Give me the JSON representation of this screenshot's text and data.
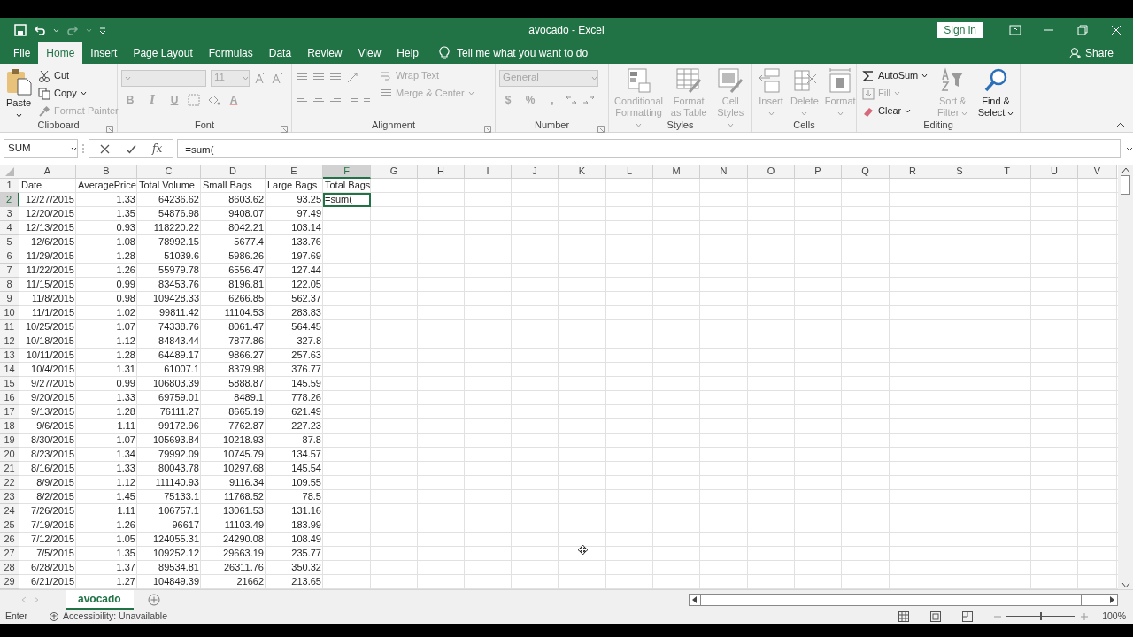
{
  "window": {
    "title": "avocado - Excel",
    "sign_in": "Sign in"
  },
  "ribbon_tabs": [
    {
      "label": "File",
      "selected": false
    },
    {
      "label": "Home",
      "selected": true
    },
    {
      "label": "Insert",
      "selected": false
    },
    {
      "label": "Page Layout",
      "selected": false
    },
    {
      "label": "Formulas",
      "selected": false
    },
    {
      "label": "Data",
      "selected": false
    },
    {
      "label": "Review",
      "selected": false
    },
    {
      "label": "View",
      "selected": false
    },
    {
      "label": "Help",
      "selected": false
    }
  ],
  "tell_me": "Tell me what you want to do",
  "share": "Share",
  "ribbon": [
    {
      "label": "Clipboard",
      "items": [
        {
          "kind": "large",
          "label": "Paste",
          "disabled": false,
          "dropdown": true
        },
        {
          "kind": "small",
          "label": "Cut",
          "disabled": false
        },
        {
          "kind": "small",
          "label": "Copy",
          "disabled": false,
          "dropdown": true
        },
        {
          "kind": "small",
          "label": "Format Painter",
          "disabled": true
        }
      ]
    },
    {
      "label": "Font",
      "items": [
        {
          "kind": "combo",
          "value": "11",
          "disabled": true
        },
        {
          "kind": "glyph",
          "label": "B",
          "disabled": true
        },
        {
          "kind": "glyph",
          "label": "I",
          "disabled": true
        },
        {
          "kind": "glyph",
          "label": "U",
          "disabled": true
        },
        {
          "kind": "glyph",
          "label": "A",
          "disabled": true
        }
      ]
    },
    {
      "label": "Alignment",
      "items": [
        {
          "kind": "small",
          "label": "Wrap Text",
          "disabled": true
        },
        {
          "kind": "small",
          "label": "Merge & Center",
          "disabled": true,
          "dropdown": true
        }
      ]
    },
    {
      "label": "Number",
      "items": [
        {
          "kind": "combo",
          "value": "General",
          "disabled": true
        },
        {
          "kind": "glyph",
          "label": "$",
          "disabled": true
        },
        {
          "kind": "glyph",
          "label": "%",
          "disabled": true
        },
        {
          "kind": "glyph",
          "label": ",",
          "disabled": true
        }
      ]
    },
    {
      "label": "Styles",
      "items": [
        {
          "kind": "large",
          "label": "Conditional Formatting",
          "disabled": true,
          "dropdown": true
        },
        {
          "kind": "large",
          "label": "Format as Table",
          "disabled": true,
          "dropdown": true
        },
        {
          "kind": "large",
          "label": "Cell Styles",
          "disabled": true,
          "dropdown": true
        }
      ]
    },
    {
      "label": "Cells",
      "items": [
        {
          "kind": "large",
          "label": "Insert",
          "disabled": true,
          "dropdown": true
        },
        {
          "kind": "large",
          "label": "Delete",
          "disabled": true,
          "dropdown": true
        },
        {
          "kind": "large",
          "label": "Format",
          "disabled": true,
          "dropdown": true
        }
      ]
    },
    {
      "label": "Editing",
      "items": [
        {
          "kind": "small",
          "label": "AutoSum",
          "disabled": false,
          "dropdown": true
        },
        {
          "kind": "small",
          "label": "Fill",
          "disabled": true,
          "dropdown": true
        },
        {
          "kind": "small",
          "label": "Clear",
          "disabled": false,
          "dropdown": true
        },
        {
          "kind": "large",
          "label": "Sort & Filter",
          "disabled": true,
          "dropdown": true
        },
        {
          "kind": "large",
          "label": "Find & Select",
          "disabled": false,
          "dropdown": true
        }
      ]
    }
  ],
  "formula_bar": {
    "name_box": "SUM",
    "function_label": "fx",
    "formula": "=sum("
  },
  "columns": [
    {
      "label": "A",
      "selected": false
    },
    {
      "label": "B",
      "selected": false
    },
    {
      "label": "C",
      "selected": false
    },
    {
      "label": "D",
      "selected": false
    },
    {
      "label": "E",
      "selected": false
    },
    {
      "label": "F",
      "selected": true
    },
    {
      "label": "G",
      "selected": false
    },
    {
      "label": "H",
      "selected": false
    },
    {
      "label": "I",
      "selected": false
    },
    {
      "label": "J",
      "selected": false
    },
    {
      "label": "K",
      "selected": false
    },
    {
      "label": "L",
      "selected": false
    },
    {
      "label": "M",
      "selected": false
    },
    {
      "label": "N",
      "selected": false
    },
    {
      "label": "O",
      "selected": false
    },
    {
      "label": "P",
      "selected": false
    },
    {
      "label": "Q",
      "selected": false
    },
    {
      "label": "R",
      "selected": false
    },
    {
      "label": "S",
      "selected": false
    },
    {
      "label": "T",
      "selected": false
    },
    {
      "label": "U",
      "selected": false
    },
    {
      "label": "V",
      "selected": false
    }
  ],
  "rows": [
    {
      "number": "1",
      "selected": false,
      "cells": [
        "Date",
        "AveragePrice",
        "Total Volume",
        "Small Bags",
        "Large Bags",
        "Total Bags"
      ]
    },
    {
      "number": "2",
      "selected": true,
      "cells": [
        "12/27/2015",
        "1.33",
        "64236.62",
        "8603.62",
        "93.25",
        "=sum("
      ]
    },
    {
      "number": "3",
      "selected": false,
      "cells": [
        "12/20/2015",
        "1.35",
        "54876.98",
        "9408.07",
        "97.49"
      ]
    },
    {
      "number": "4",
      "selected": false,
      "cells": [
        "12/13/2015",
        "0.93",
        "118220.22",
        "8042.21",
        "103.14"
      ]
    },
    {
      "number": "5",
      "selected": false,
      "cells": [
        "12/6/2015",
        "1.08",
        "78992.15",
        "5677.4",
        "133.76"
      ]
    },
    {
      "number": "6",
      "selected": false,
      "cells": [
        "11/29/2015",
        "1.28",
        "51039.6",
        "5986.26",
        "197.69"
      ]
    },
    {
      "number": "7",
      "selected": false,
      "cells": [
        "11/22/2015",
        "1.26",
        "55979.78",
        "6556.47",
        "127.44"
      ]
    },
    {
      "number": "8",
      "selected": false,
      "cells": [
        "11/15/2015",
        "0.99",
        "83453.76",
        "8196.81",
        "122.05"
      ]
    },
    {
      "number": "9",
      "selected": false,
      "cells": [
        "11/8/2015",
        "0.98",
        "109428.33",
        "6266.85",
        "562.37"
      ]
    },
    {
      "number": "10",
      "selected": false,
      "cells": [
        "11/1/2015",
        "1.02",
        "99811.42",
        "11104.53",
        "283.83"
      ]
    },
    {
      "number": "11",
      "selected": false,
      "cells": [
        "10/25/2015",
        "1.07",
        "74338.76",
        "8061.47",
        "564.45"
      ]
    },
    {
      "number": "12",
      "selected": false,
      "cells": [
        "10/18/2015",
        "1.12",
        "84843.44",
        "7877.86",
        "327.8"
      ]
    },
    {
      "number": "13",
      "selected": false,
      "cells": [
        "10/11/2015",
        "1.28",
        "64489.17",
        "9866.27",
        "257.63"
      ]
    },
    {
      "number": "14",
      "selected": false,
      "cells": [
        "10/4/2015",
        "1.31",
        "61007.1",
        "8379.98",
        "376.77"
      ]
    },
    {
      "number": "15",
      "selected": false,
      "cells": [
        "9/27/2015",
        "0.99",
        "106803.39",
        "5888.87",
        "145.59"
      ]
    },
    {
      "number": "16",
      "selected": false,
      "cells": [
        "9/20/2015",
        "1.33",
        "69759.01",
        "8489.1",
        "778.26"
      ]
    },
    {
      "number": "17",
      "selected": false,
      "cells": [
        "9/13/2015",
        "1.28",
        "76111.27",
        "8665.19",
        "621.49"
      ]
    },
    {
      "number": "18",
      "selected": false,
      "cells": [
        "9/6/2015",
        "1.11",
        "99172.96",
        "7762.87",
        "227.23"
      ]
    },
    {
      "number": "19",
      "selected": false,
      "cells": [
        "8/30/2015",
        "1.07",
        "105693.84",
        "10218.93",
        "87.8"
      ]
    },
    {
      "number": "20",
      "selected": false,
      "cells": [
        "8/23/2015",
        "1.34",
        "79992.09",
        "10745.79",
        "134.57"
      ]
    },
    {
      "number": "21",
      "selected": false,
      "cells": [
        "8/16/2015",
        "1.33",
        "80043.78",
        "10297.68",
        "145.54"
      ]
    },
    {
      "number": "22",
      "selected": false,
      "cells": [
        "8/9/2015",
        "1.12",
        "111140.93",
        "9116.34",
        "109.55"
      ]
    },
    {
      "number": "23",
      "selected": false,
      "cells": [
        "8/2/2015",
        "1.45",
        "75133.1",
        "11768.52",
        "78.5"
      ]
    },
    {
      "number": "24",
      "selected": false,
      "cells": [
        "7/26/2015",
        "1.11",
        "106757.1",
        "13061.53",
        "131.16"
      ]
    },
    {
      "number": "25",
      "selected": false,
      "cells": [
        "7/19/2015",
        "1.26",
        "96617",
        "11103.49",
        "183.99"
      ]
    },
    {
      "number": "26",
      "selected": false,
      "cells": [
        "7/12/2015",
        "1.05",
        "124055.31",
        "24290.08",
        "108.49"
      ]
    },
    {
      "number": "27",
      "selected": false,
      "cells": [
        "7/5/2015",
        "1.35",
        "109252.12",
        "29663.19",
        "235.77"
      ]
    },
    {
      "number": "28",
      "selected": false,
      "cells": [
        "6/28/2015",
        "1.37",
        "89534.81",
        "26311.76",
        "350.32"
      ]
    },
    {
      "number": "29",
      "selected": false,
      "cells": [
        "6/21/2015",
        "1.27",
        "104849.39",
        "21662",
        "213.65"
      ]
    }
  ],
  "sheet_tabs": [
    {
      "label": "avocado",
      "selected": true
    }
  ],
  "status_bar": {
    "mode": "Enter",
    "accessibility": "Accessibility: Unavailable",
    "zoom": {
      "label": "100%",
      "level": 0.5
    }
  }
}
